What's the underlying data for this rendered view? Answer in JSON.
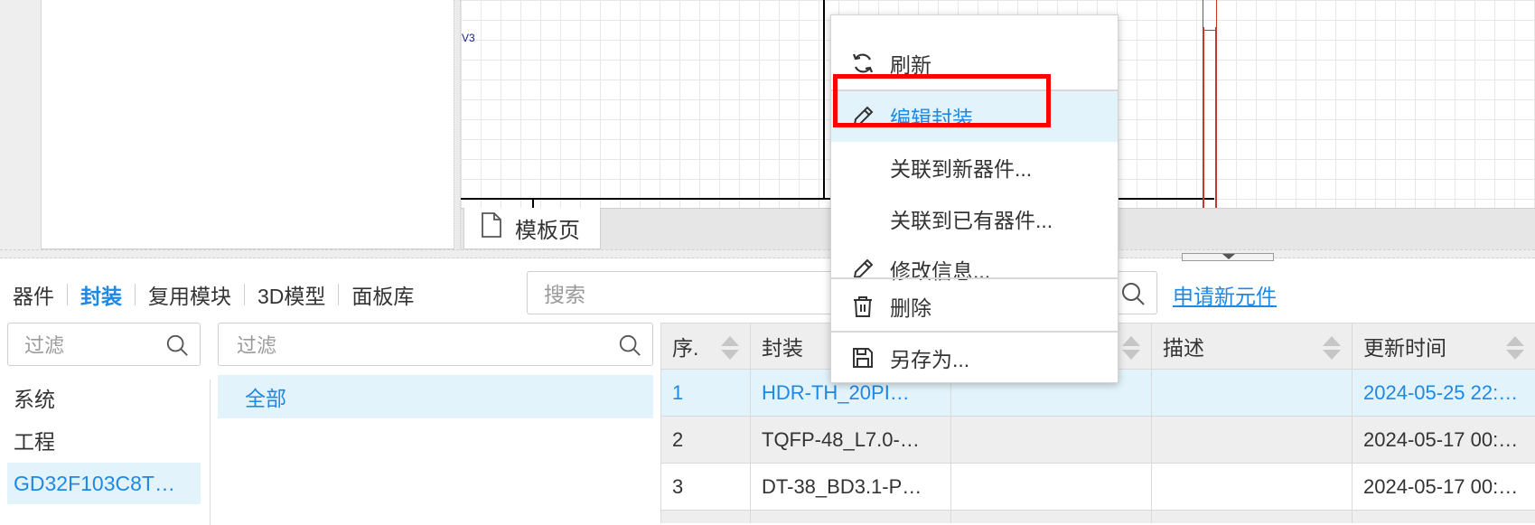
{
  "canvas": {
    "net_label": "V3",
    "doc_tab": {
      "label": "模板页",
      "icon": "document-icon"
    }
  },
  "library": {
    "tabs": [
      {
        "label": "器件",
        "active": false
      },
      {
        "label": "封装",
        "active": true
      },
      {
        "label": "复用模块",
        "active": false
      },
      {
        "label": "3D模型",
        "active": false
      },
      {
        "label": "面板库",
        "active": false
      }
    ],
    "search_placeholder": "搜索",
    "apply_link": "申请新元件",
    "filter_placeholder_left": "过滤",
    "filter_placeholder_right": "过滤",
    "categories": [
      {
        "label": "系统",
        "selected": false
      },
      {
        "label": "工程",
        "selected": false
      },
      {
        "label": "GD32F103C8T…",
        "selected": true
      }
    ],
    "all_label": "全部"
  },
  "table": {
    "columns": [
      "序.",
      "封装",
      "",
      "描述",
      "更新时间"
    ],
    "rows": [
      [
        "1",
        "HDR-TH_20PI…",
        "",
        "",
        "2024-05-25 22:…"
      ],
      [
        "2",
        "TQFP-48_L7.0-…",
        "",
        "",
        "2024-05-17 00:…"
      ],
      [
        "3",
        "DT-38_BD3.1-P…",
        "",
        "",
        "2024-05-17 00:…"
      ]
    ],
    "selected_row": 0
  },
  "context_menu": {
    "items": [
      {
        "label": "刷新",
        "icon": "refresh-icon",
        "highlighted": false
      },
      {
        "label": "编辑封装",
        "icon": "pencil-icon",
        "highlighted": true
      },
      {
        "label": "关联到新器件...",
        "icon": "",
        "highlighted": false
      },
      {
        "label": "关联到已有器件...",
        "icon": "",
        "highlighted": false
      },
      {
        "label": "修改信息...",
        "icon": "pencil-icon",
        "highlighted": false
      },
      {
        "label": "删除",
        "icon": "trash-icon",
        "highlighted": false
      },
      {
        "label": "另存为...",
        "icon": "save-icon",
        "highlighted": false
      }
    ]
  },
  "colors": {
    "accent": "#1e88e5",
    "highlight_bg": "#e3f3fb",
    "annotation_box": "#ff0000"
  }
}
